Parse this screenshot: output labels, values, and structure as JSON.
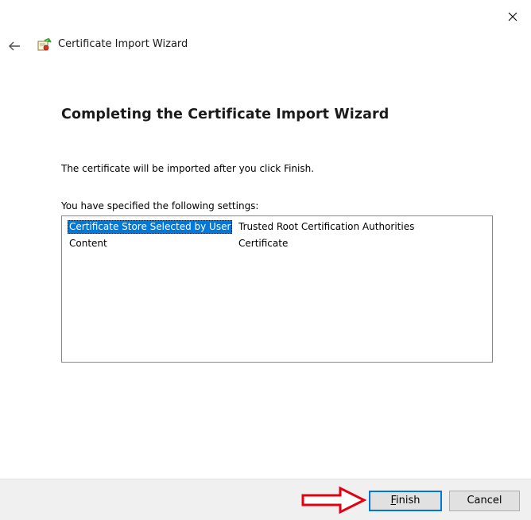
{
  "window": {
    "title": "Certificate Import Wizard",
    "close_icon": "close-icon",
    "back_icon": "back-arrow-icon",
    "app_icon": "certificate-icon"
  },
  "main": {
    "heading": "Completing the Certificate Import Wizard",
    "intro": "The certificate will be imported after you click Finish.",
    "settings_label": "You have specified the following settings:",
    "settings": [
      {
        "name": "Certificate Store Selected by User",
        "value": "Trusted Root Certification Authorities",
        "selected": true
      },
      {
        "name": "Content",
        "value": "Certificate",
        "selected": false
      }
    ]
  },
  "footer": {
    "finish_mnemonic": "F",
    "finish_rest": "inish",
    "cancel_label": "Cancel",
    "annotation_icon": "red-arrow-icon"
  },
  "colors": {
    "selection": "#0078d7",
    "annotation_arrow": "#e3000f",
    "footer_bg": "#f0f0f0"
  }
}
